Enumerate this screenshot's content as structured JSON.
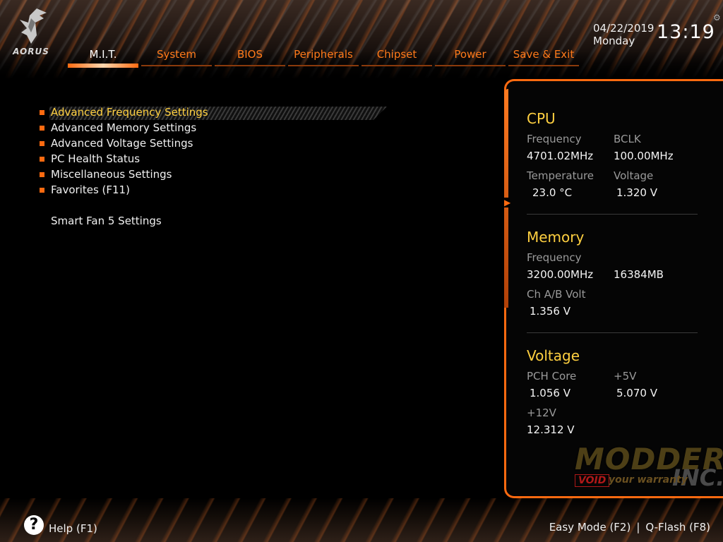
{
  "brand": {
    "logo_text": "AORUS"
  },
  "datetime": {
    "date": "04/22/2019",
    "day": "Monday",
    "time": "13:19"
  },
  "tabs": [
    {
      "label": "M.I.T.",
      "active": true
    },
    {
      "label": "System"
    },
    {
      "label": "BIOS"
    },
    {
      "label": "Peripherals"
    },
    {
      "label": "Chipset"
    },
    {
      "label": "Power"
    },
    {
      "label": "Save & Exit"
    }
  ],
  "menu": {
    "items": [
      {
        "label": "Advanced Frequency Settings",
        "selected": true
      },
      {
        "label": "Advanced Memory Settings"
      },
      {
        "label": "Advanced Voltage Settings"
      },
      {
        "label": "PC Health Status"
      },
      {
        "label": "Miscellaneous Settings"
      },
      {
        "label": "Favorites (F11)"
      }
    ],
    "extra_item": "Smart Fan 5 Settings"
  },
  "panel": {
    "cpu": {
      "title": "CPU",
      "frequency_label": "Frequency",
      "frequency_value": "4701.02MHz",
      "bclk_label": "BCLK",
      "bclk_value": "100.00MHz",
      "temperature_label": "Temperature",
      "temperature_value": "23.0 °C",
      "voltage_label": "Voltage",
      "voltage_value": "1.320 V"
    },
    "memory": {
      "title": "Memory",
      "frequency_label": "Frequency",
      "frequency_value": "3200.00MHz",
      "size_value": "16384MB",
      "chab_label": "Ch A/B Volt",
      "chab_value": "1.356 V"
    },
    "voltage": {
      "title": "Voltage",
      "pch_label": "PCH Core",
      "pch_value": "1.056 V",
      "p5v_label": "+5V",
      "p5v_value": "5.070 V",
      "p12v_label": "+12V",
      "p12v_value": "12.312 V"
    }
  },
  "watermark": {
    "top": "MODDERS",
    "inc": "INC.",
    "void": "VOID",
    "warranty": "your warranty"
  },
  "footer": {
    "help_icon": "?",
    "help_label": "Help (F1)",
    "easy_mode": "Easy Mode (F2)",
    "separator": "|",
    "qflash": "Q-Flash (F8)"
  },
  "colors": {
    "accent": "#ff6a10",
    "highlight": "#ffd040",
    "tab_text": "#ff7a1a"
  }
}
